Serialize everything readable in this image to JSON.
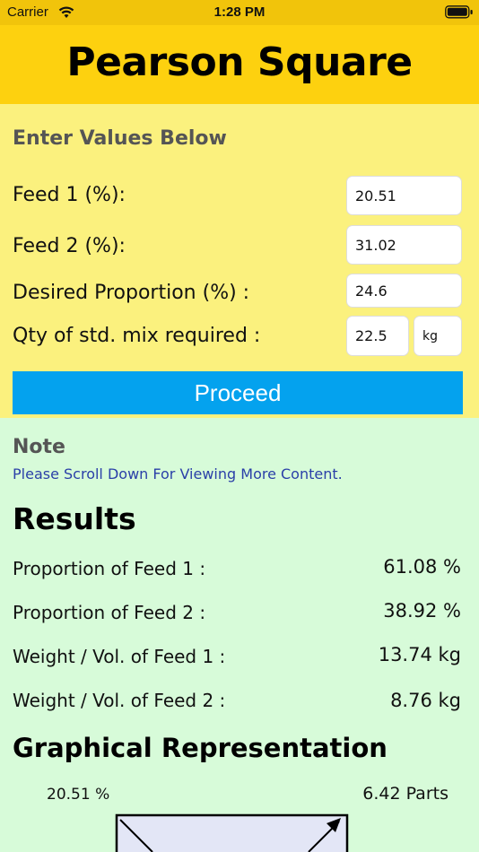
{
  "status": {
    "carrier": "Carrier",
    "time": "1:28 PM"
  },
  "app": {
    "title": "Pearson Square"
  },
  "form": {
    "heading": "Enter Values Below",
    "feed1_label": "Feed 1 (%):",
    "feed1_value": "20.51",
    "feed2_label": "Feed 2 (%):",
    "feed2_value": "31.02",
    "desired_label": "Desired Proportion (%) :",
    "desired_value": "24.6",
    "qty_label": "Qty of std. mix required :",
    "qty_value": "22.5",
    "unit_value": "kg",
    "proceed_label": "Proceed"
  },
  "note": {
    "heading": "Note",
    "text": "Please Scroll Down For Viewing More Content."
  },
  "results": {
    "heading": "Results",
    "rows": [
      {
        "label": "Proportion of Feed 1  :",
        "value": "61.08 %"
      },
      {
        "label": "Proportion of Feed 2  :",
        "value": "38.92 %"
      },
      {
        "label": "Weight / Vol. of Feed 1 :",
        "value": "13.74 kg"
      },
      {
        "label": "Weight / Vol. of Feed 2 :",
        "value": "8.76 kg"
      }
    ]
  },
  "graph": {
    "heading": "Graphical Representation",
    "left_value": "20.51 %",
    "right_value": "6.42 Parts"
  },
  "colors": {
    "header": "#fdd10f",
    "status": "#f1c40b",
    "panel": "#fbf17e",
    "results_bg": "#d7fbd9",
    "button": "#04a2ee",
    "note_text": "#2a3fa8"
  }
}
